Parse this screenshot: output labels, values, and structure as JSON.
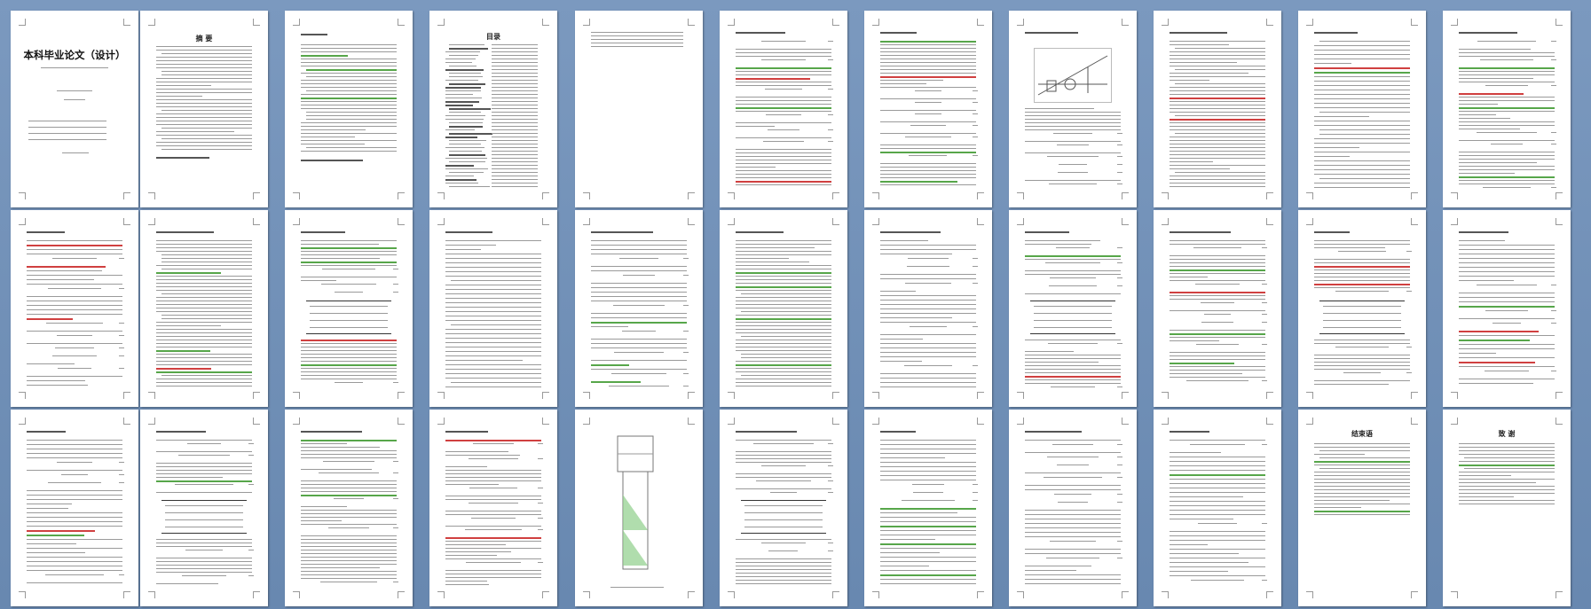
{
  "document": {
    "cover_title": "本科毕业论文（设计）",
    "abstract_cn_title": "摘 要",
    "toc_title": "目录",
    "conclusion_title": "结束语",
    "thanks_title": "致 谢"
  },
  "thumbnails": {
    "page_count": 33
  }
}
